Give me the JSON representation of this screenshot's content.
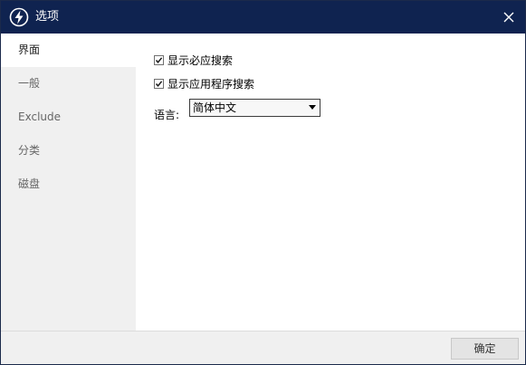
{
  "window": {
    "title": "选项",
    "close_icon": "close-icon",
    "logo_icon": "lightning-logo-icon",
    "titlebar_color": "#0f2350"
  },
  "sidebar": {
    "items": [
      {
        "label": "界面",
        "active": true
      },
      {
        "label": "一般",
        "active": false
      },
      {
        "label": "Exclude",
        "active": false
      },
      {
        "label": "分类",
        "active": false
      },
      {
        "label": "磁盘",
        "active": false
      }
    ]
  },
  "options": {
    "show_required_search": {
      "label": "显示必应搜索",
      "checked": true
    },
    "show_app_search": {
      "label": "显示应用程序搜索",
      "checked": true
    },
    "language": {
      "label": "语言:",
      "value": "简体中文"
    }
  },
  "footer": {
    "ok_label": "确定"
  }
}
